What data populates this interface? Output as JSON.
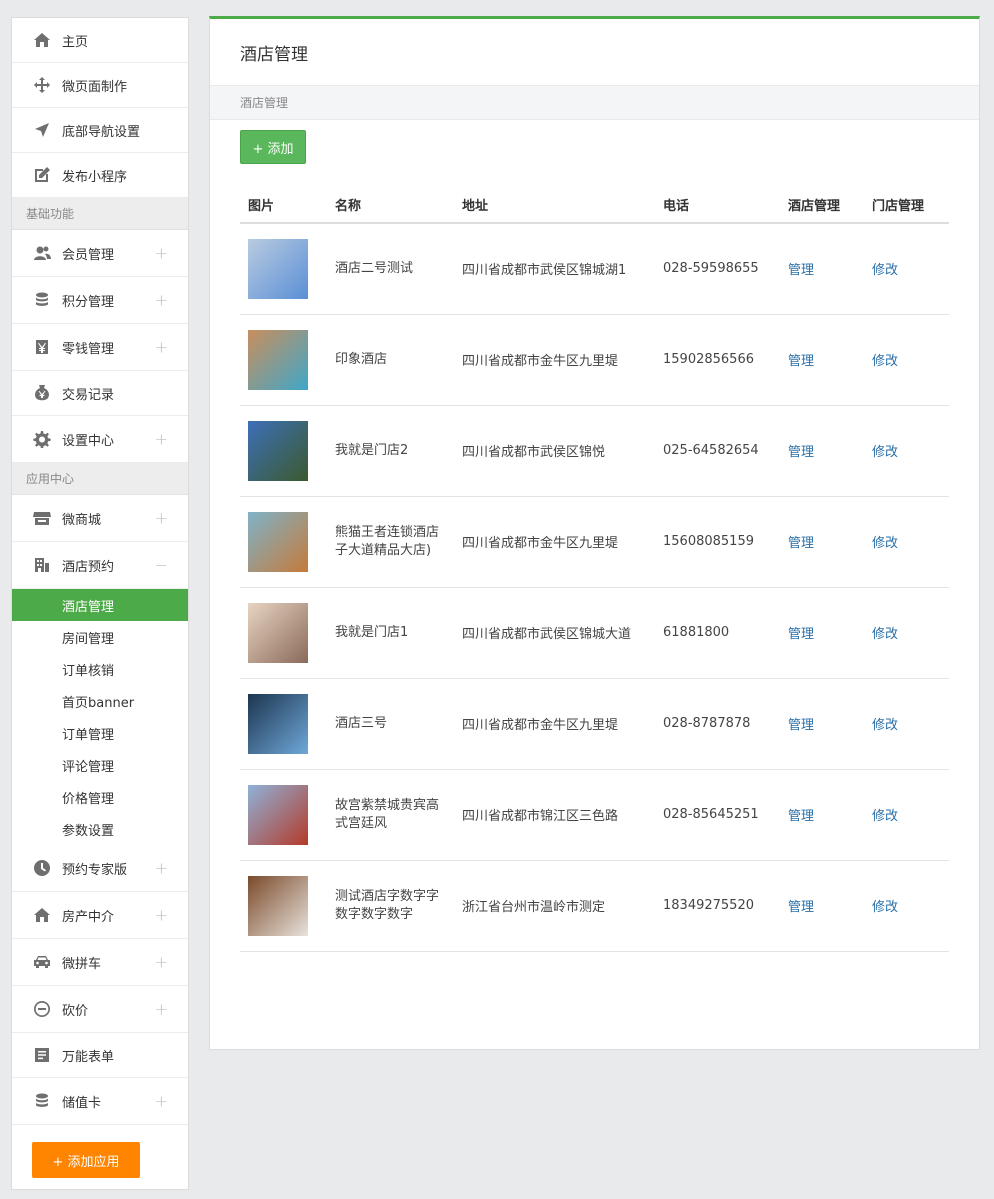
{
  "sidebar": {
    "top_items": [
      {
        "label": "主页",
        "icon": "home-icon"
      },
      {
        "label": "微页面制作",
        "icon": "move-icon"
      },
      {
        "label": "底部导航设置",
        "icon": "navigation-arrow-icon"
      },
      {
        "label": "发布小程序",
        "icon": "edit-square-icon"
      }
    ],
    "group_basic": "基础功能",
    "basic_items": [
      {
        "label": "会员管理",
        "icon": "users-icon",
        "toggle": "+"
      },
      {
        "label": "积分管理",
        "icon": "coins-stack-icon",
        "toggle": "+"
      },
      {
        "label": "零钱管理",
        "icon": "wallet-yen-icon",
        "toggle": "+"
      },
      {
        "label": "交易记录",
        "icon": "money-bag-yen-icon",
        "toggle": ""
      },
      {
        "label": "设置中心",
        "icon": "gear-icon",
        "toggle": "+"
      }
    ],
    "group_apps": "应用中心",
    "app_items_top": [
      {
        "label": "微商城",
        "icon": "store-icon",
        "toggle": "+"
      },
      {
        "label": "酒店预约",
        "icon": "building-icon",
        "toggle": "−"
      }
    ],
    "hotel_sub": [
      "酒店管理",
      "房间管理",
      "订单核销",
      "首页banner",
      "订单管理",
      "评论管理",
      "价格管理",
      "参数设置"
    ],
    "app_items_bottom": [
      {
        "label": "预约专家版",
        "icon": "clock-icon",
        "toggle": "+"
      },
      {
        "label": "房产中介",
        "icon": "house-icon",
        "toggle": "+"
      },
      {
        "label": "微拼车",
        "icon": "car-icon",
        "toggle": "+"
      },
      {
        "label": "砍价",
        "icon": "minus-circle-icon",
        "toggle": "+"
      },
      {
        "label": "万能表单",
        "icon": "form-icon",
        "toggle": ""
      },
      {
        "label": "储值卡",
        "icon": "coins-stack-icon",
        "toggle": "+"
      }
    ],
    "add_app_label": "+ 添加应用"
  },
  "main": {
    "title": "酒店管理",
    "breadcrumb": "酒店管理",
    "add_label": "+ 添加",
    "columns": [
      "图片",
      "名称",
      "地址",
      "电话",
      "酒店管理",
      "门店管理"
    ],
    "rows": [
      {
        "name": "酒店二号测试",
        "address": "四川省成都市武侯区锦城湖1",
        "phone": "028-59598655",
        "manage": "管理",
        "edit": "修改",
        "thumb": [
          "#b9cbe0",
          "#5a8fd6"
        ]
      },
      {
        "name": "印象酒店",
        "address": "四川省成都市金牛区九里堤",
        "phone": "15902856566",
        "manage": "管理",
        "edit": "修改",
        "thumb": [
          "#c98e5d",
          "#3fa7c8"
        ]
      },
      {
        "name": "我就是门店2",
        "address": "四川省成都市武侯区锦悦",
        "phone": "025-64582654",
        "manage": "管理",
        "edit": "修改",
        "thumb": [
          "#3d6fb8",
          "#3b5a2e"
        ]
      },
      {
        "name": "熊猫王者连锁酒店子大道精品大店)",
        "address": "四川省成都市金牛区九里堤",
        "phone": "15608085159",
        "manage": "管理",
        "edit": "修改",
        "thumb": [
          "#7fb3c9",
          "#c47a3a"
        ]
      },
      {
        "name": "我就是门店1",
        "address": "四川省成都市武侯区锦城大道",
        "phone": "61881800",
        "manage": "管理",
        "edit": "修改",
        "thumb": [
          "#e8d4c2",
          "#8a6a5a"
        ]
      },
      {
        "name": "酒店三号",
        "address": "四川省成都市金牛区九里堤",
        "phone": "028-8787878",
        "manage": "管理",
        "edit": "修改",
        "thumb": [
          "#1c3550",
          "#6fa8d8"
        ]
      },
      {
        "name": "故宫紫禁城贵宾高式宫廷风",
        "address": "四川省成都市锦江区三色路",
        "phone": "028-85645251",
        "manage": "管理",
        "edit": "修改",
        "thumb": [
          "#8fb2d8",
          "#b33a2a"
        ]
      },
      {
        "name": "测试酒店字数字字数字数字数字",
        "address": "浙江省台州市温岭市测定",
        "phone": "18349275520",
        "manage": "管理",
        "edit": "修改",
        "thumb": [
          "#7a4a2a",
          "#e8e2dc"
        ]
      }
    ]
  },
  "colors": {
    "accent": "#4caa48",
    "add_button": "#5bb75b",
    "add_app": "#ff8400",
    "link": "#2a6fa8"
  }
}
